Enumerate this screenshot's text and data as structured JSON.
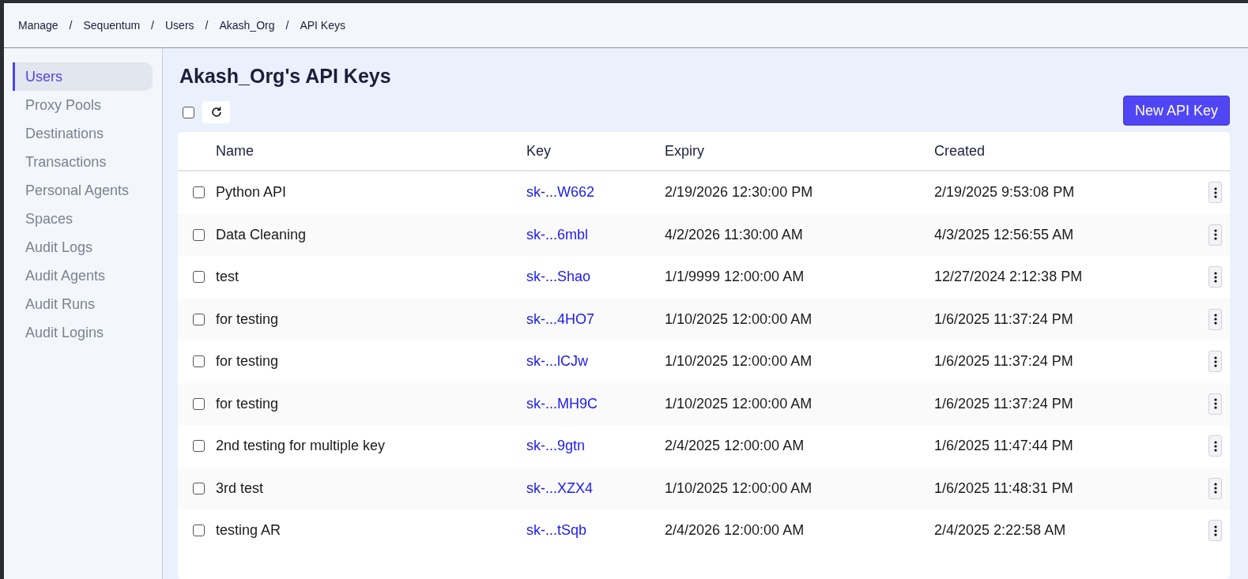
{
  "breadcrumb": [
    "Manage",
    "Sequentum",
    "Users",
    "Akash_Org",
    "API Keys"
  ],
  "breadcrumb_separator": "/",
  "sidebar": {
    "items": [
      {
        "label": "Users",
        "selected": true
      },
      {
        "label": "Proxy Pools",
        "selected": false
      },
      {
        "label": "Destinations",
        "selected": false
      },
      {
        "label": "Transactions",
        "selected": false
      },
      {
        "label": "Personal Agents",
        "selected": false
      },
      {
        "label": "Spaces",
        "selected": false
      },
      {
        "label": "Audit Logs",
        "selected": false
      },
      {
        "label": "Audit Agents",
        "selected": false
      },
      {
        "label": "Audit Runs",
        "selected": false
      },
      {
        "label": "Audit Logins",
        "selected": false
      }
    ]
  },
  "page_title": "Akash_Org's API Keys",
  "toolbar": {
    "select_all_checked": false,
    "new_button": "New API Key"
  },
  "table": {
    "columns": [
      "Name",
      "Key",
      "Expiry",
      "Created"
    ],
    "rows": [
      {
        "checked": false,
        "name": "Python API",
        "key": "sk-...W662",
        "expiry": "2/19/2026 12:30:00 PM",
        "created": "2/19/2025 9:53:08 PM"
      },
      {
        "checked": false,
        "name": "Data Cleaning",
        "key": "sk-...6mbl",
        "expiry": "4/2/2026 11:30:00 AM",
        "created": "4/3/2025 12:56:55 AM"
      },
      {
        "checked": false,
        "name": "test",
        "key": "sk-...Shao",
        "expiry": "1/1/9999 12:00:00 AM",
        "created": "12/27/2024 2:12:38 PM"
      },
      {
        "checked": false,
        "name": "for testing",
        "key": "sk-...4HO7",
        "expiry": "1/10/2025 12:00:00 AM",
        "created": "1/6/2025 11:37:24 PM"
      },
      {
        "checked": false,
        "name": "for testing",
        "key": "sk-...lCJw",
        "expiry": "1/10/2025 12:00:00 AM",
        "created": "1/6/2025 11:37:24 PM"
      },
      {
        "checked": false,
        "name": "for testing",
        "key": "sk-...MH9C",
        "expiry": "1/10/2025 12:00:00 AM",
        "created": "1/6/2025 11:37:24 PM"
      },
      {
        "checked": false,
        "name": "2nd testing for multiple key",
        "key": "sk-...9gtn",
        "expiry": "2/4/2025 12:00:00 AM",
        "created": "1/6/2025 11:47:44 PM"
      },
      {
        "checked": false,
        "name": "3rd test",
        "key": "sk-...XZX4",
        "expiry": "1/10/2025 12:00:00 AM",
        "created": "1/6/2025 11:48:31 PM"
      },
      {
        "checked": false,
        "name": "testing AR",
        "key": "sk-...tSqb",
        "expiry": "2/4/2026 12:00:00 AM",
        "created": "2/4/2025 2:22:58 AM"
      }
    ]
  }
}
